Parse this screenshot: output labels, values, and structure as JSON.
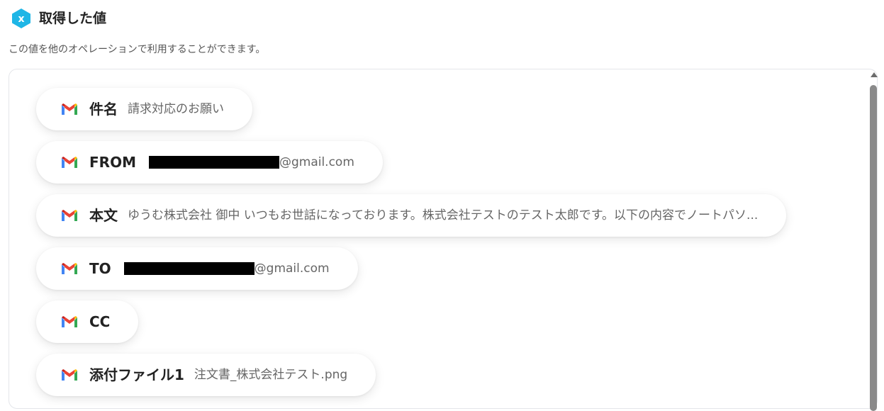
{
  "header": {
    "icon": "x-hexagon-icon",
    "icon_letter": "x",
    "icon_color": "#1fb6e6",
    "title": "取得した値"
  },
  "description": "この値を他のオペレーションで利用することができます。",
  "fields": [
    {
      "icon": "gmail-icon",
      "label": "件名",
      "value": "請求対応のお願い"
    },
    {
      "icon": "gmail-icon",
      "label": "FROM",
      "redacted": true,
      "value": "@gmail.com"
    },
    {
      "icon": "gmail-icon",
      "label": "本文",
      "value": "ゆうむ株式会社 御中 いつもお世話になっております。株式会社テストのテスト太郎です。以下の内容でノートパソ..."
    },
    {
      "icon": "gmail-icon",
      "label": "TO",
      "redacted": true,
      "value": "@gmail.com"
    },
    {
      "icon": "gmail-icon",
      "label": "CC",
      "value": ""
    },
    {
      "icon": "gmail-icon",
      "label": "添付ファイル1",
      "value": "注文書_株式会社テスト.png"
    }
  ],
  "colors": {
    "gmail_red": "#ea4335",
    "gmail_blue": "#4285f4",
    "gmail_green": "#34a853",
    "gmail_yellow": "#fbbc04",
    "redaction": "#000000"
  }
}
